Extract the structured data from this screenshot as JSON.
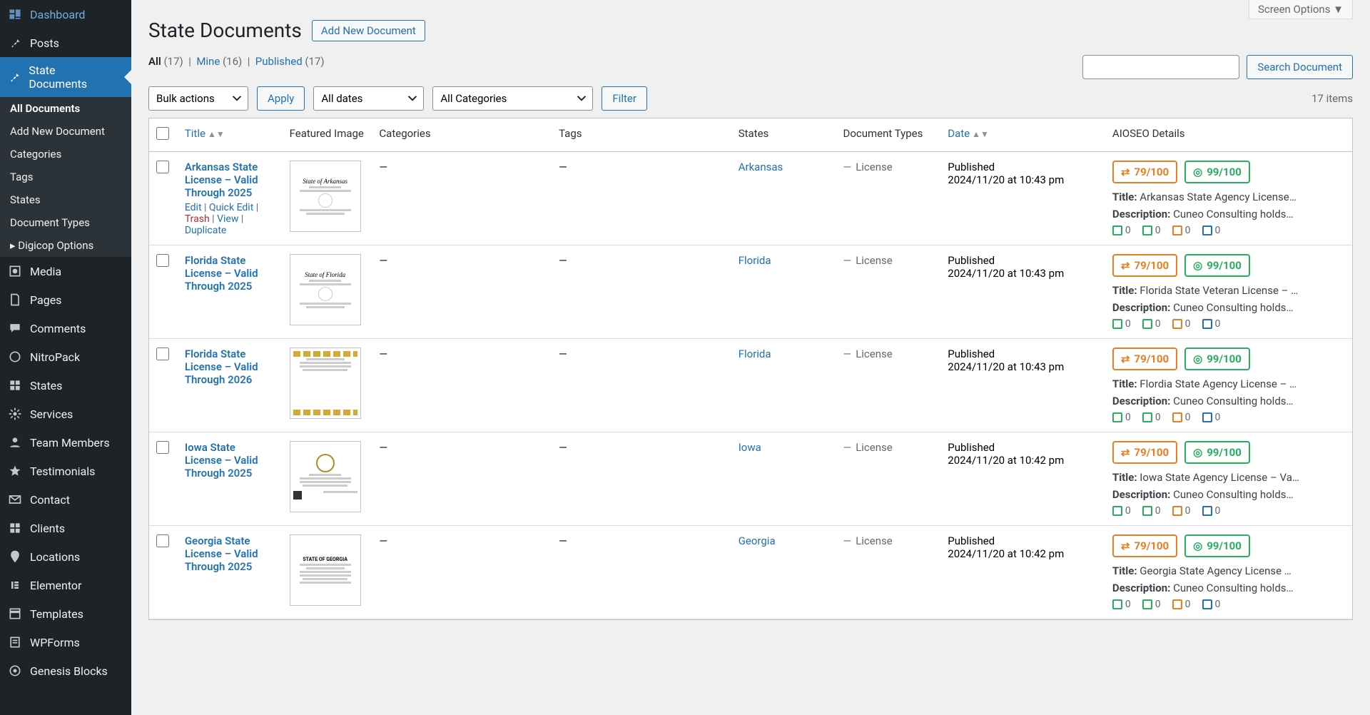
{
  "screen_options": "Screen Options ▼",
  "page_title": "State Documents",
  "add_new": "Add New Document",
  "subsub": {
    "all_label": "All",
    "all_count": "(17)",
    "mine_label": "Mine",
    "mine_count": "(16)",
    "published_label": "Published",
    "published_count": "(17)"
  },
  "search_button": "Search Document",
  "tablenav": {
    "bulk_actions": "Bulk actions",
    "apply": "Apply",
    "all_dates": "All dates",
    "all_categories": "All Categories",
    "filter": "Filter",
    "items_count": "17 items"
  },
  "columns": {
    "title": "Title",
    "featured_image": "Featured Image",
    "categories": "Categories",
    "tags": "Tags",
    "states": "States",
    "document_types": "Document Types",
    "date": "Date",
    "aioseo": "AIOSEO Details"
  },
  "row_actions": {
    "edit": "Edit",
    "quick": "Quick Edit",
    "trash": "Trash",
    "view": "View",
    "dup": "Duplicate"
  },
  "sidebar": [
    {
      "icon": "dashboard",
      "label": "Dashboard"
    },
    {
      "icon": "pin",
      "label": "Posts"
    },
    {
      "icon": "pin",
      "label": "State Documents",
      "active": true
    },
    {
      "icon": "media",
      "label": "Media"
    },
    {
      "icon": "page",
      "label": "Pages"
    },
    {
      "icon": "comments",
      "label": "Comments"
    },
    {
      "icon": "nitro",
      "label": "NitroPack"
    },
    {
      "icon": "grid",
      "label": "States"
    },
    {
      "icon": "gear",
      "label": "Services"
    },
    {
      "icon": "team",
      "label": "Team Members"
    },
    {
      "icon": "star",
      "label": "Testimonials"
    },
    {
      "icon": "mail",
      "label": "Contact"
    },
    {
      "icon": "grid",
      "label": "Clients"
    },
    {
      "icon": "pin2",
      "label": "Locations"
    },
    {
      "icon": "elementor",
      "label": "Elementor"
    },
    {
      "icon": "templates",
      "label": "Templates"
    },
    {
      "icon": "wpforms",
      "label": "WPForms"
    },
    {
      "icon": "genesis",
      "label": "Genesis Blocks"
    }
  ],
  "submenu": [
    {
      "label": "All Documents",
      "current": true
    },
    {
      "label": "Add New Document"
    },
    {
      "label": "Categories"
    },
    {
      "label": "Tags"
    },
    {
      "label": "States"
    },
    {
      "label": "Document Types"
    },
    {
      "label": "Digicop Options",
      "hasArrow": true
    }
  ],
  "rows": [
    {
      "title": "Arkansas State License – Valid Through 2025",
      "thumb_head": "State of Arkansas",
      "show_actions": true,
      "categories": "—",
      "tags": "—",
      "state": "Arkansas",
      "doctype": "License",
      "date_status": "Published",
      "date_time": "2024/11/20 at 10:43 pm",
      "seo1": "79/100",
      "seo2": "99/100",
      "aio_title": "Arkansas State Agency License…",
      "aio_desc": "Cuneo Consulting holds…"
    },
    {
      "title": "Florida State License – Valid Through 2025",
      "thumb_head": "State of Florida",
      "categories": "—",
      "tags": "—",
      "state": "Florida",
      "doctype": "License",
      "date_status": "Published",
      "date_time": "2024/11/20 at 10:43 pm",
      "seo1": "79/100",
      "seo2": "99/100",
      "aio_title": "Florida State Veteran License – …",
      "aio_desc": "Cuneo Consulting holds…"
    },
    {
      "title": "Florida State License – Valid Through 2026",
      "thumb_head": "",
      "thumb_variant": "yellow",
      "categories": "—",
      "tags": "—",
      "state": "Florida",
      "doctype": "License",
      "date_status": "Published",
      "date_time": "2024/11/20 at 10:43 pm",
      "seo1": "79/100",
      "seo2": "99/100",
      "aio_title": "Flordia State Agency License – …",
      "aio_desc": "Cuneo Consulting holds…"
    },
    {
      "title": "Iowa State License – Valid Through 2025",
      "thumb_head": "",
      "thumb_variant": "seal",
      "categories": "—",
      "tags": "—",
      "state": "Iowa",
      "doctype": "License",
      "date_status": "Published",
      "date_time": "2024/11/20 at 10:42 pm",
      "seo1": "79/100",
      "seo2": "99/100",
      "aio_title": "Iowa State Agency License – Va…",
      "aio_desc": "Cuneo Consulting holds…"
    },
    {
      "title": "Georgia State License – Valid Through 2025",
      "thumb_head": "STATE OF GEORGIA",
      "thumb_variant": "text",
      "categories": "—",
      "tags": "—",
      "state": "Georgia",
      "doctype": "License",
      "date_status": "Published",
      "date_time": "2024/11/20 at 10:42 pm",
      "seo1": "79/100",
      "seo2": "99/100",
      "aio_title": "Georgia State Agency License …",
      "aio_desc": "Cuneo Consulting holds…"
    }
  ],
  "labels": {
    "title_prefix": "Title:",
    "desc_prefix": "Description:",
    "zero": "0"
  }
}
